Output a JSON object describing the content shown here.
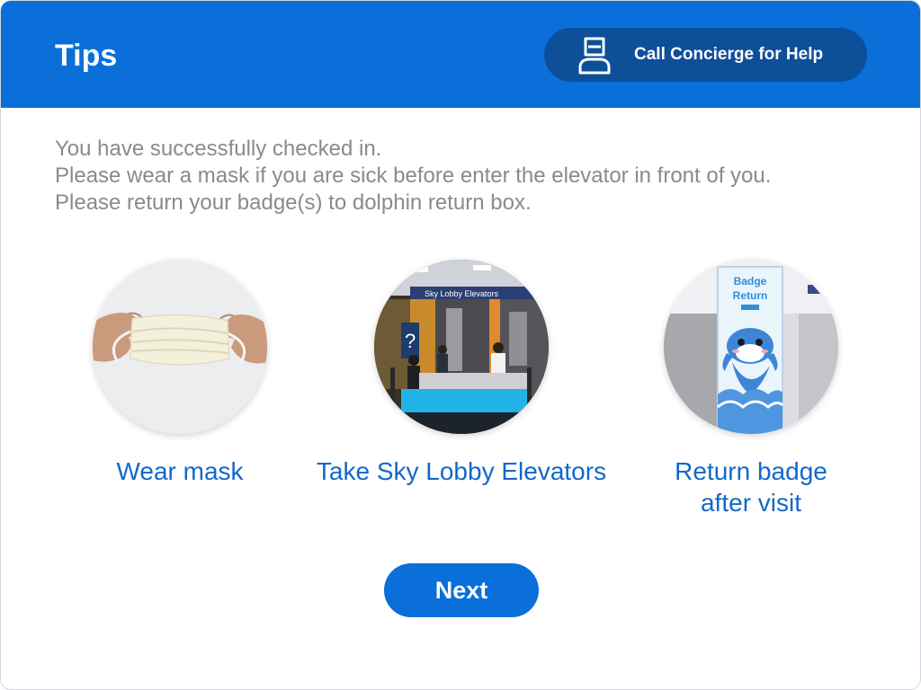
{
  "header": {
    "title": "Tips",
    "concierge_button": {
      "label": "Call Concierge for Help",
      "icon": "concierge-person-icon"
    }
  },
  "messages": [
    "You have successfully checked in.",
    "Please wear a mask if you are sick before enter the elevator in front of you.",
    "Please return your badge(s) to dolphin return box."
  ],
  "tips": [
    {
      "label": "Wear mask",
      "icon": "face-mask-photo"
    },
    {
      "label": "Take Sky Lobby Elevators",
      "icon": "sky-lobby-photo",
      "sign_text": "Sky Lobby Elevators"
    },
    {
      "label_lines": [
        "Return badge",
        "after visit"
      ],
      "icon": "badge-return-box-photo",
      "box_text": [
        "Badge",
        "Return"
      ]
    }
  ],
  "next_button": {
    "label": "Next"
  },
  "colors": {
    "header_bg": "#0a6fd8",
    "concierge_button_bg": "#0d4f99",
    "message_text": "#8a8a8a",
    "tip_label": "#1268c9",
    "next_button_bg": "#0a6fd8"
  }
}
